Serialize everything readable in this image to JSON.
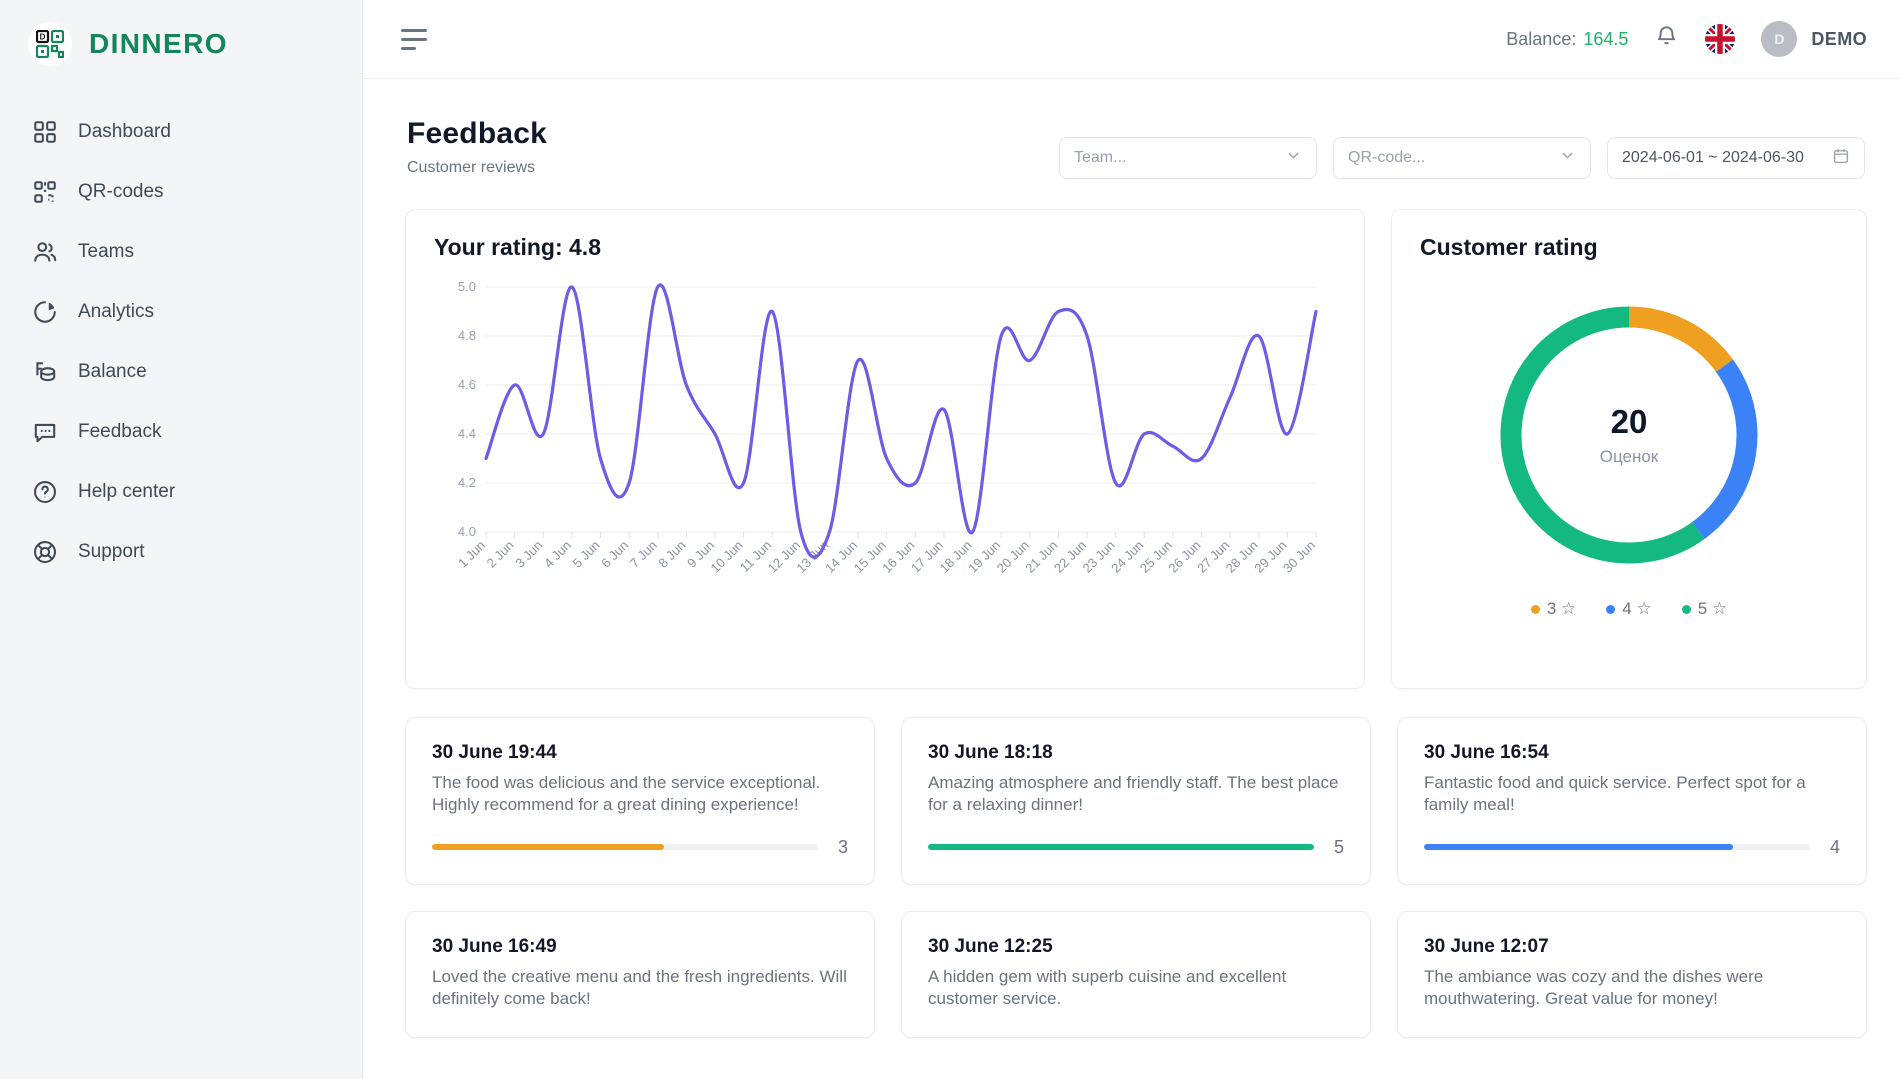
{
  "brand": {
    "name": "DINNERO",
    "logo_icon": "qr-logo-icon"
  },
  "sidebar": {
    "items": [
      {
        "label": "Dashboard",
        "icon": "grid-icon"
      },
      {
        "label": "QR-codes",
        "icon": "qr-code-icon"
      },
      {
        "label": "Teams",
        "icon": "users-icon"
      },
      {
        "label": "Analytics",
        "icon": "pie-chart-icon"
      },
      {
        "label": "Balance",
        "icon": "coins-icon"
      },
      {
        "label": "Feedback",
        "icon": "chat-bubble-icon"
      },
      {
        "label": "Help center",
        "icon": "question-circle-icon"
      },
      {
        "label": "Support",
        "icon": "lifebuoy-icon"
      }
    ]
  },
  "topbar": {
    "menu_icon": "hamburger-icon",
    "balance_label": "Balance:",
    "balance_value": "164.5",
    "notification_icon": "bell-icon",
    "language_icon": "flag-gb-icon",
    "avatar_initial": "D",
    "user_name": "DEMO"
  },
  "page": {
    "title": "Feedback",
    "subtitle": "Customer reviews"
  },
  "filters": {
    "team_placeholder": "Team...",
    "qr_placeholder": "QR-code...",
    "date_range": "2024-06-01 ~ 2024-06-30"
  },
  "chart_data": [
    {
      "type": "line",
      "title": "Your rating: 4.8",
      "average_rating": "4.8",
      "xlabel": "",
      "ylabel": "",
      "ylim": [
        4.0,
        5.0
      ],
      "yticks": [
        "4.0",
        "4.2",
        "4.4",
        "4.6",
        "4.8",
        "5.0"
      ],
      "grid": true,
      "line_color": "#6c5ce7",
      "categories": [
        "1 Jun",
        "2 Jun",
        "3 Jun",
        "4 Jun",
        "5 Jun",
        "6 Jun",
        "7 Jun",
        "8 Jun",
        "9 Jun",
        "10 Jun",
        "11 Jun",
        "12 Jun",
        "13 Jun",
        "14 Jun",
        "15 Jun",
        "16 Jun",
        "17 Jun",
        "18 Jun",
        "19 Jun",
        "20 Jun",
        "21 Jun",
        "22 Jun",
        "23 Jun",
        "24 Jun",
        "25 Jun",
        "26 Jun",
        "27 Jun",
        "28 Jun",
        "29 Jun",
        "30 Jun"
      ],
      "values": [
        4.3,
        4.6,
        4.4,
        5.0,
        4.3,
        4.2,
        5.0,
        4.6,
        4.4,
        4.2,
        4.9,
        4.0,
        4.0,
        4.7,
        4.3,
        4.2,
        4.5,
        4.0,
        4.8,
        4.7,
        4.9,
        4.8,
        4.2,
        4.4,
        4.35,
        4.3,
        4.55,
        4.8,
        4.4,
        4.9
      ]
    },
    {
      "type": "pie",
      "title": "Customer rating",
      "center_value": "20",
      "center_label": "Оценок",
      "labels": [
        "3 ☆",
        "4 ☆",
        "5 ☆"
      ],
      "values": [
        3,
        5,
        12
      ],
      "percent": [
        15,
        25,
        60
      ],
      "colors": [
        "#f0a020",
        "#3b82f6",
        "#13b981"
      ],
      "legend_position": "bottom"
    }
  ],
  "reviews": [
    {
      "time": "30 June 19:44",
      "text": "The food was delicious and the service exceptional. Highly recommend for a great dining experience!",
      "rating": "3",
      "percent": 60,
      "color": "#f0a020",
      "has_bar": true
    },
    {
      "time": "30 June 18:18",
      "text": "Amazing atmosphere and friendly staff. The best place for a relaxing dinner!",
      "rating": "5",
      "percent": 100,
      "color": "#13b981",
      "has_bar": true
    },
    {
      "time": "30 June 16:54",
      "text": "Fantastic food and quick service. Perfect spot for a family meal!",
      "rating": "4",
      "percent": 80,
      "color": "#3b82f6",
      "has_bar": true
    },
    {
      "time": "30 June 16:49",
      "text": "Loved the creative menu and the fresh ingredients. Will definitely come back!",
      "rating": "",
      "percent": 0,
      "color": "#13b981",
      "has_bar": false
    },
    {
      "time": "30 June 12:25",
      "text": "A hidden gem with superb cuisine and excellent customer service.",
      "rating": "",
      "percent": 0,
      "color": "#13b981",
      "has_bar": false
    },
    {
      "time": "30 June 12:07",
      "text": "The ambiance was cozy and the dishes were mouthwatering. Great value for money!",
      "rating": "",
      "percent": 0,
      "color": "#13b981",
      "has_bar": false
    }
  ]
}
